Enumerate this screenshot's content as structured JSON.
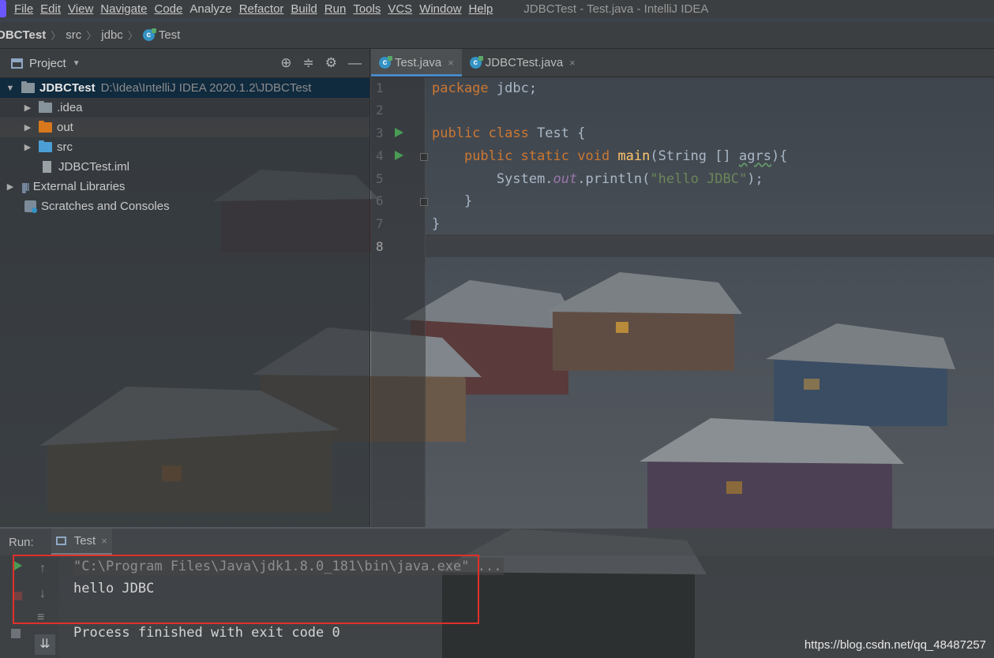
{
  "menu": {
    "items": [
      "File",
      "Edit",
      "View",
      "Navigate",
      "Code",
      "Analyze",
      "Refactor",
      "Build",
      "Run",
      "Tools",
      "VCS",
      "Window",
      "Help"
    ],
    "window_title": "JDBCTest - Test.java - IntelliJ IDEA"
  },
  "navbar": {
    "crumbs": [
      "DBCTest",
      "src",
      "jdbc",
      "Test"
    ]
  },
  "project": {
    "title": "Project",
    "tree": [
      {
        "label": "JDBCTest",
        "path": "D:\\Idea\\IntelliJ IDEA 2020.1.2\\JDBCTest"
      },
      {
        "label": ".idea"
      },
      {
        "label": "out"
      },
      {
        "label": "src"
      },
      {
        "label": "JDBCTest.iml"
      },
      {
        "label": "External Libraries"
      },
      {
        "label": "Scratches and Consoles"
      }
    ]
  },
  "editor": {
    "tabs": [
      {
        "label": "Test.java",
        "close": "×"
      },
      {
        "label": "JDBCTest.java",
        "close": "×"
      }
    ],
    "line_numbers": [
      "1",
      "2",
      "3",
      "4",
      "5",
      "6",
      "7",
      "8"
    ],
    "code": {
      "l1_kw": "package",
      "l1_rest": " jdbc;",
      "l3_kw": "public class",
      "l3_rest": " Test {",
      "l4_kw": "public static void",
      "l4_fn": "main",
      "l4_a": "(String [] ",
      "l4_typo": "agrs",
      "l4_b": "){",
      "l5_a": "System.",
      "l5_out": "out",
      "l5_b": ".println(",
      "l5_str": "\"hello JDBC\"",
      "l5_c": ");",
      "l6": "}",
      "l7": "}"
    }
  },
  "run": {
    "label": "Run:",
    "tab_label": "Test",
    "tab_close": "×",
    "console": {
      "command": "\"C:\\Program Files\\Java\\jdk1.8.0_181\\bin\\java.exe\" ...",
      "output": "hello JDBC",
      "exit": "Process finished with exit code 0"
    }
  },
  "watermark": "https://blog.csdn.net/qq_48487257",
  "colors": {
    "keyword": "#cc7832",
    "function": "#ffc66d",
    "string": "#6a8759",
    "field": "#9876aa",
    "run_green": "#499c54",
    "highlight_box": "#e0302b"
  }
}
